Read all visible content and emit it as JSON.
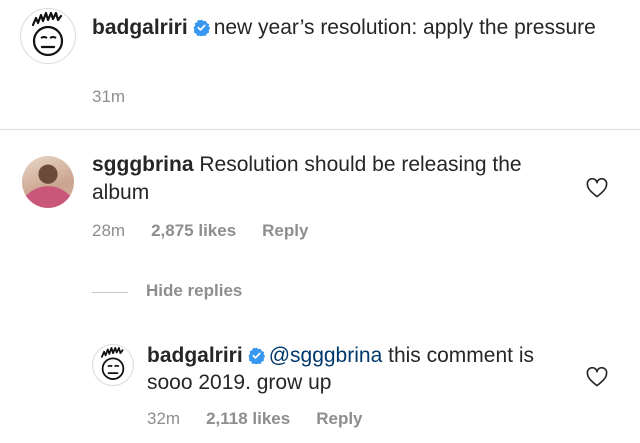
{
  "caption": {
    "username": "badgalriri",
    "text": "new year’s resolution: apply the pressure",
    "time": "31m"
  },
  "comments": [
    {
      "username": "sgggbrina",
      "text": "Resolution should be releasing the album",
      "time": "28m",
      "likes": "2,875 likes",
      "reply_label": "Reply",
      "hide_replies_label": "Hide replies",
      "replies": [
        {
          "username": "badgalriri",
          "mention": "@sgggbrina",
          "text": "this comment is sooo 2019. grow up",
          "time": "32m",
          "likes": "2,118 likes",
          "reply_label": "Reply"
        }
      ]
    }
  ],
  "icons": {
    "verified": "verified-badge-icon",
    "like": "heart-icon"
  },
  "colors": {
    "verified": "#3897f0",
    "meta_text": "#8e8e8e",
    "mention": "#00376b"
  }
}
